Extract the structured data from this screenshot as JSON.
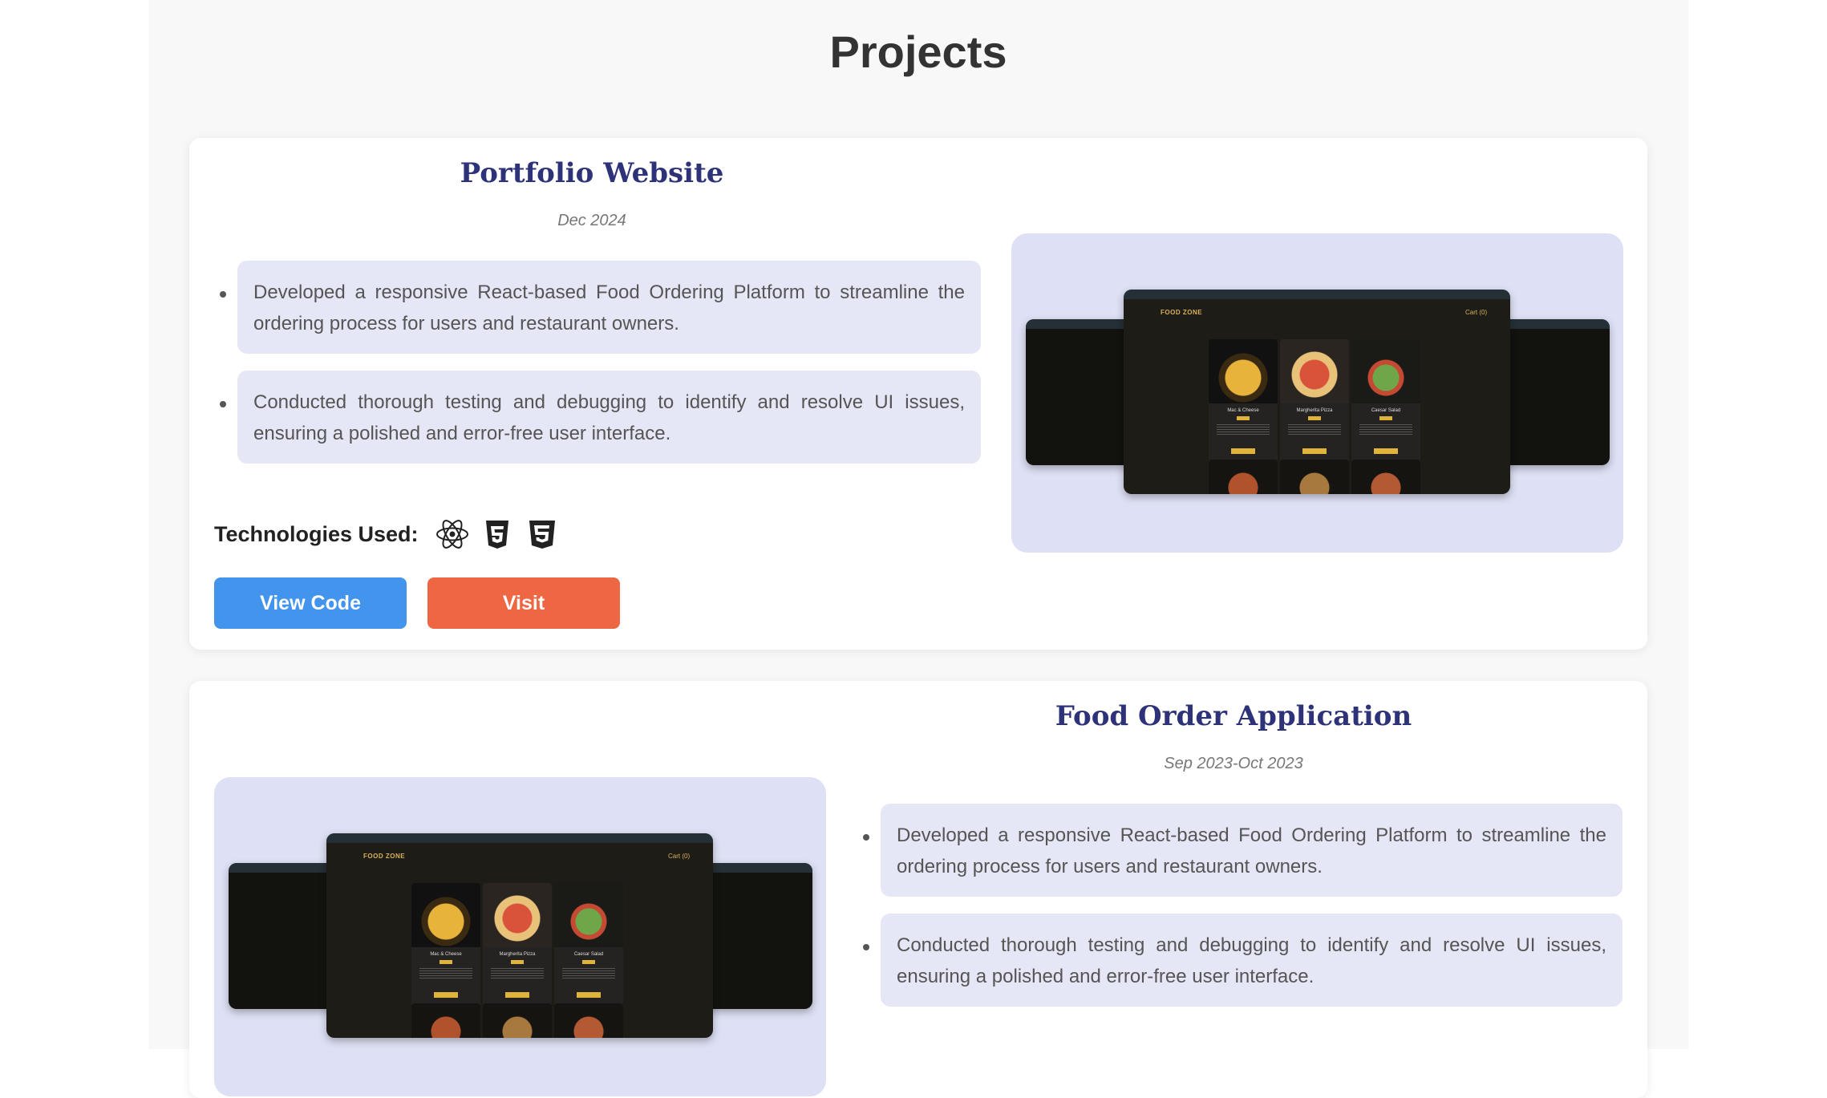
{
  "page": {
    "heading": "Projects"
  },
  "projects": [
    {
      "title": "Portfolio Website",
      "date": "Dec 2024",
      "bullets": [
        "Developed a responsive React-based Food Ordering Platform to streamline the ordering process for users and restaurant owners.",
        "Conducted thorough testing and debugging to identify and resolve UI issues, ensuring a polished and error-free user interface."
      ],
      "tech_label": "Technologies Used:",
      "tech_icons": [
        "react-icon",
        "html5-icon",
        "css3-icon"
      ],
      "view_code_label": "View Code",
      "visit_label": "Visit"
    },
    {
      "title": "Food Order Application",
      "date": "Sep 2023-Oct 2023",
      "bullets": [
        "Developed a responsive React-based Food Ordering Platform to streamline the ordering process for users and restaurant owners.",
        "Conducted thorough testing and debugging to identify and resolve UI issues, ensuring a polished and error-free user interface."
      ]
    }
  ],
  "preview": {
    "brand": "FOOD ZONE",
    "cart": "Cart (0)",
    "items": [
      "Mac & Cheese",
      "Margherita Pizza",
      "Caesar Salad"
    ]
  },
  "colors": {
    "view_code": "#4294ec",
    "visit": "#ef6643",
    "title": "#2d3279",
    "bullet_bg": "#e5e6f6",
    "preview_bg": "#dee0f5"
  }
}
